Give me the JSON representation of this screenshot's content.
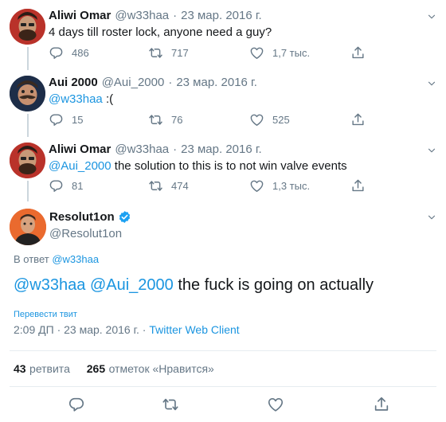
{
  "tweets": [
    {
      "name": "Aliwi Omar",
      "handle": "@w33haa",
      "date": "23 мар. 2016 г.",
      "mention": "",
      "text": "4 days till roster lock, anyone need a guy?",
      "replies": "486",
      "retweets": "717",
      "likes": "1,7 тыс."
    },
    {
      "name": "Aui 2000",
      "handle": "@Aui_2000",
      "date": "23 мар. 2016 г.",
      "mention": "@w33haa",
      "text": ":(",
      "replies": "15",
      "retweets": "76",
      "likes": "525"
    },
    {
      "name": "Aliwi Omar",
      "handle": "@w33haa",
      "date": "23 мар. 2016 г.",
      "mention": "@Aui_2000",
      "text": "the solution to this is to not win valve events",
      "replies": "81",
      "retweets": "474",
      "likes": "1,3 тыс."
    }
  ],
  "main": {
    "name": "Resolut1on",
    "handle": "@Resolut1on",
    "reply_prefix": "В ответ",
    "reply_to": "@w33haa",
    "mention1": "@w33haa",
    "mention2": "@Aui_2000",
    "text": "the fuck is going on actually",
    "translate": "Перевести твит",
    "time": "2:09 ДП · 23 мар. 2016 г. ·",
    "client": "Twitter Web Client",
    "retweets_count": "43",
    "retweets_label": "ретвита",
    "likes_count": "265",
    "likes_label": "отметок «Нравится»"
  },
  "colors": {
    "accent": "#1b95e0",
    "secondary": "#657786",
    "verified": "#1da1f2"
  }
}
